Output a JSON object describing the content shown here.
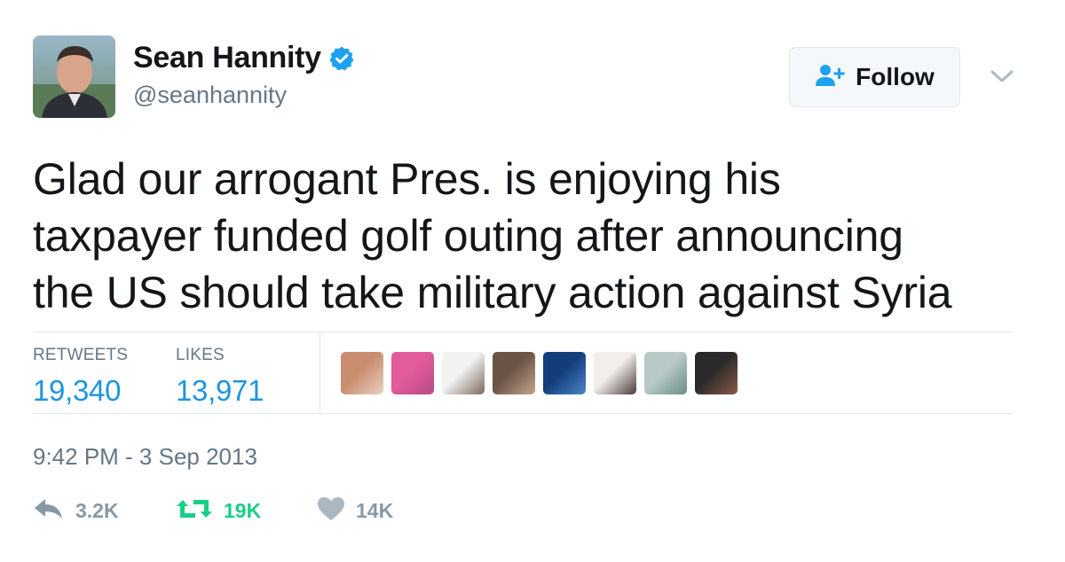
{
  "author": {
    "name": "Sean Hannity",
    "handle": "@seanhannity",
    "verified_icon": "verified-badge-icon"
  },
  "header": {
    "follow_label": "Follow",
    "menu_icon": "chevron-down-icon"
  },
  "tweet": {
    "lines": [
      "Glad our arrogant Pres. is enjoying his",
      "taxpayer funded golf outing after announcing",
      "the US should take military action against Syria"
    ]
  },
  "stats": {
    "retweets_label": "RETWEETS",
    "retweets_value": "19,340",
    "likes_label": "LIKES",
    "likes_value": "13,971"
  },
  "likers": [
    {
      "colors": [
        "#c98d6f",
        "#e7d3c1"
      ]
    },
    {
      "colors": [
        "#e25b9b",
        "#b84a86"
      ]
    },
    {
      "colors": [
        "#f2f2f2",
        "#7a6a5e"
      ]
    },
    {
      "colors": [
        "#6b5446",
        "#c4a690"
      ]
    },
    {
      "colors": [
        "#123d7a",
        "#4c85c8"
      ]
    },
    {
      "colors": [
        "#f1eeec",
        "#4a3a36"
      ]
    },
    {
      "colors": [
        "#b9c9c7",
        "#6b8e88"
      ]
    },
    {
      "colors": [
        "#2a2a2a",
        "#8a5a4a"
      ]
    }
  ],
  "timestamp": "9:42 PM - 3 Sep 2013",
  "actions": {
    "reply_count": "3.2K",
    "retweet_count": "19K",
    "like_count": "14K"
  },
  "colors": {
    "accent": "#1b95e0",
    "retweet_green": "#19cf86",
    "muted": "#657786"
  }
}
